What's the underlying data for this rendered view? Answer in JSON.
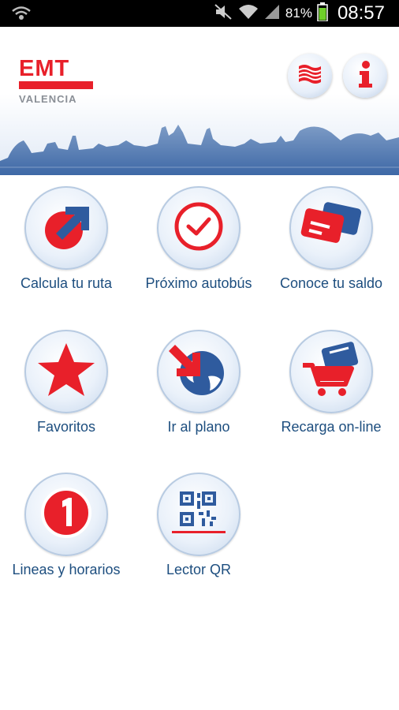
{
  "status_bar": {
    "battery": "81%",
    "time": "08:57"
  },
  "header": {
    "logo_name": "EMT",
    "logo_sub": "VALENCIA",
    "buttons": [
      {
        "icon": "flag-icon"
      },
      {
        "icon": "info-icon"
      }
    ]
  },
  "menu": {
    "items": [
      {
        "label": "Calcula tu ruta",
        "icon": "route-arrow-icon"
      },
      {
        "label": "Próximo autobús",
        "icon": "clock-icon"
      },
      {
        "label": "Conoce tu saldo",
        "icon": "cards-icon"
      },
      {
        "label": "Favoritos",
        "icon": "star-icon"
      },
      {
        "label": "Ir al plano",
        "icon": "globe-arrow-icon"
      },
      {
        "label": "Recarga on-line",
        "icon": "cart-card-icon"
      },
      {
        "label": "Lineas y horarios",
        "icon": "line-one-icon"
      },
      {
        "label": "Lector QR",
        "icon": "qr-icon"
      }
    ]
  },
  "colors": {
    "brand_red": "#e8202a",
    "brand_blue": "#2f5b9e",
    "label_blue": "#1d4e7f"
  }
}
